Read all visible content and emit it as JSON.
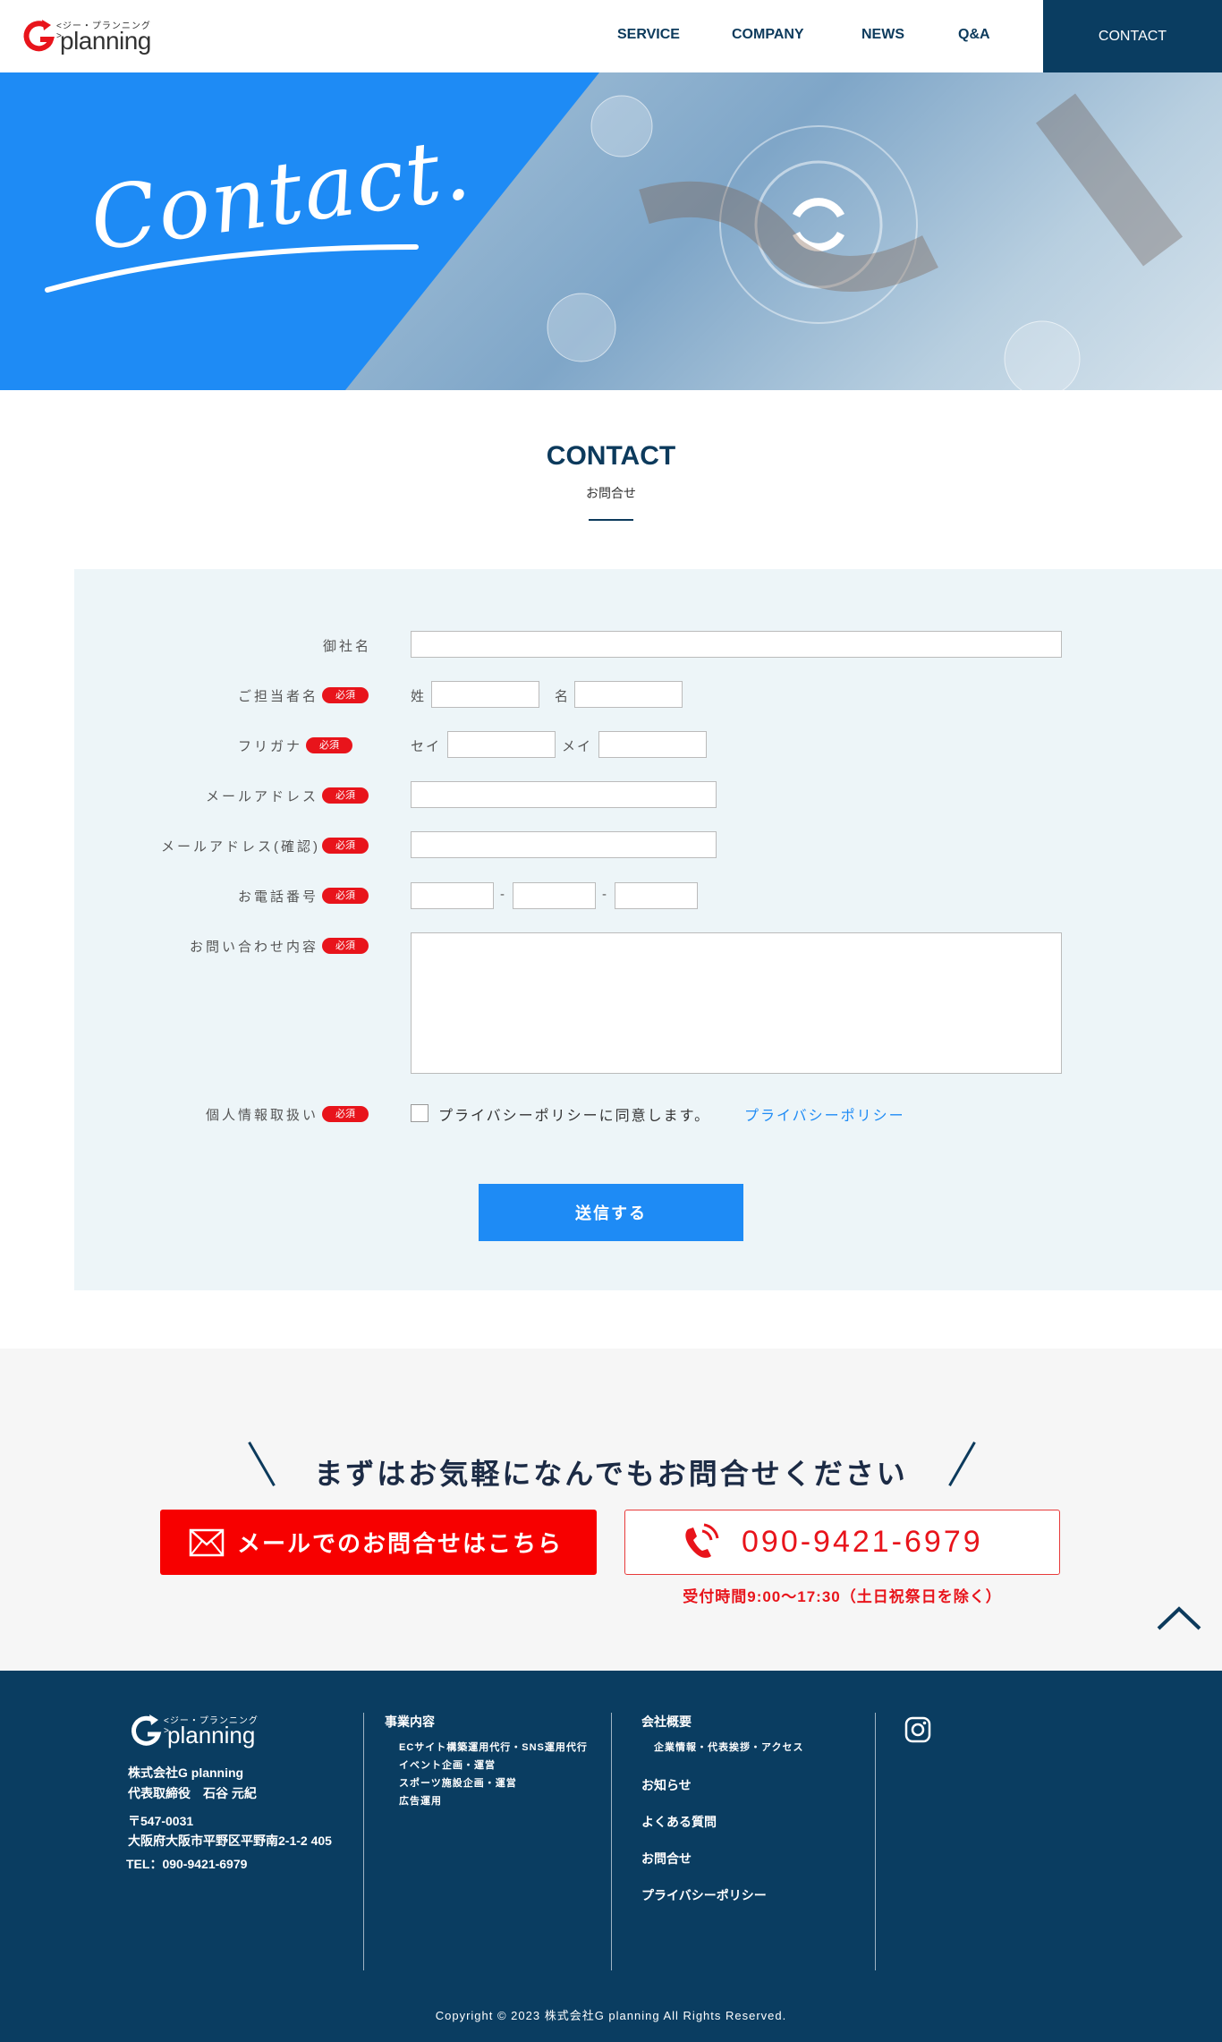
{
  "header": {
    "logo_kana": "<ジー・プランニング>",
    "logo_word": "planning",
    "nav": [
      "SERVICE",
      "COMPANY",
      "NEWS",
      "Q&A"
    ],
    "contact": "CONTACT"
  },
  "hero": {
    "script_text": "Contact."
  },
  "section": {
    "title": "CONTACT",
    "subtitle": "お問合せ"
  },
  "form": {
    "company_label": "御社名",
    "person_label": "ご担当者名",
    "last_name": "姓",
    "first_name": "名",
    "kana_label": "フリガナ",
    "kana_last": "セイ",
    "kana_first": "メイ",
    "email_label": "メールアドレス",
    "email_confirm_label": "メールアドレス(確認)",
    "phone_label": "お電話番号",
    "phone_sep": "-",
    "inquiry_label": "お問い合わせ内容",
    "privacy_label": "個人情報取扱い",
    "privacy_agree": "プライバシーポリシーに同意します。",
    "privacy_link": "プライバシーポリシー",
    "required": "必須",
    "submit": "送信する"
  },
  "cta": {
    "title": "まずはお気軽になんでもお問合せください",
    "mail_button": "メールでのお問合せはこちら",
    "phone": "090-9421-6979",
    "hours": "受付時間9:00～17:30（土日祝祭日を除く）"
  },
  "footer": {
    "logo_kana": "<ジー・プランニング>",
    "logo_word": "planning",
    "company": "株式会社G planning",
    "ceo": "代表取締役　石谷 元紀",
    "zip": "〒547-0031",
    "address": "大阪府大阪市平野区平野南2-1-2 405",
    "tel": "TEL：090-9421-6979",
    "services_heading": "事業内容",
    "services": [
      "ECサイト構築運用代行・SNS運用代行",
      "イベント企画・運営",
      "スポーツ施設企画・運営",
      "広告運用"
    ],
    "company_heading": "会社概要",
    "company_sub": "企業情報・代表挨拶・アクセス",
    "links": [
      "お知らせ",
      "よくある質問",
      "お問合せ",
      "プライバシーポリシー"
    ],
    "copyright": "Copyright © 2023 株式会社G planning All Rights Reserved."
  },
  "colors": {
    "navy": "#0a3d61",
    "blue": "#1e8bf5",
    "red": "#e8141b"
  }
}
